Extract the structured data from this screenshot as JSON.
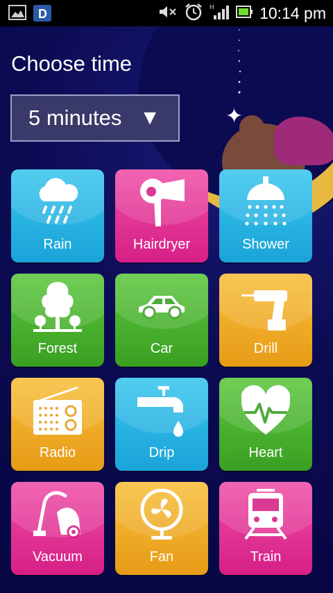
{
  "status_bar": {
    "time": "10:14 pm",
    "icons": [
      "gallery-icon",
      "app-d-icon",
      "mute-icon",
      "alarm-icon",
      "signal-icon",
      "battery-icon"
    ],
    "app_badge_letter": "D",
    "network_letter": "H"
  },
  "app": {
    "title": "Choose time",
    "time_select": {
      "value": "5 minutes",
      "arrow": "▼"
    }
  },
  "tiles": [
    {
      "label": "Rain",
      "color": "#1aa3d8",
      "icon": "rain-cloud-icon"
    },
    {
      "label": "Hairdryer",
      "color": "#d61f86",
      "icon": "hairdryer-icon"
    },
    {
      "label": "Shower",
      "color": "#1aa3d8",
      "icon": "shower-icon"
    },
    {
      "label": "Forest",
      "color": "#3a9f22",
      "icon": "tree-icon"
    },
    {
      "label": "Car",
      "color": "#3a9f22",
      "icon": "car-icon"
    },
    {
      "label": "Drill",
      "color": "#e79b16",
      "icon": "drill-icon"
    },
    {
      "label": "Radio",
      "color": "#e79b16",
      "icon": "radio-icon"
    },
    {
      "label": "Drip",
      "color": "#1aa3d8",
      "icon": "faucet-icon"
    },
    {
      "label": "Heart",
      "color": "#3a9f22",
      "icon": "heartbeat-icon"
    },
    {
      "label": "Vacuum",
      "color": "#d61f86",
      "icon": "vacuum-icon"
    },
    {
      "label": "Fan",
      "color": "#e79b16",
      "icon": "fan-icon"
    },
    {
      "label": "Train",
      "color": "#d61f86",
      "icon": "train-icon"
    }
  ]
}
